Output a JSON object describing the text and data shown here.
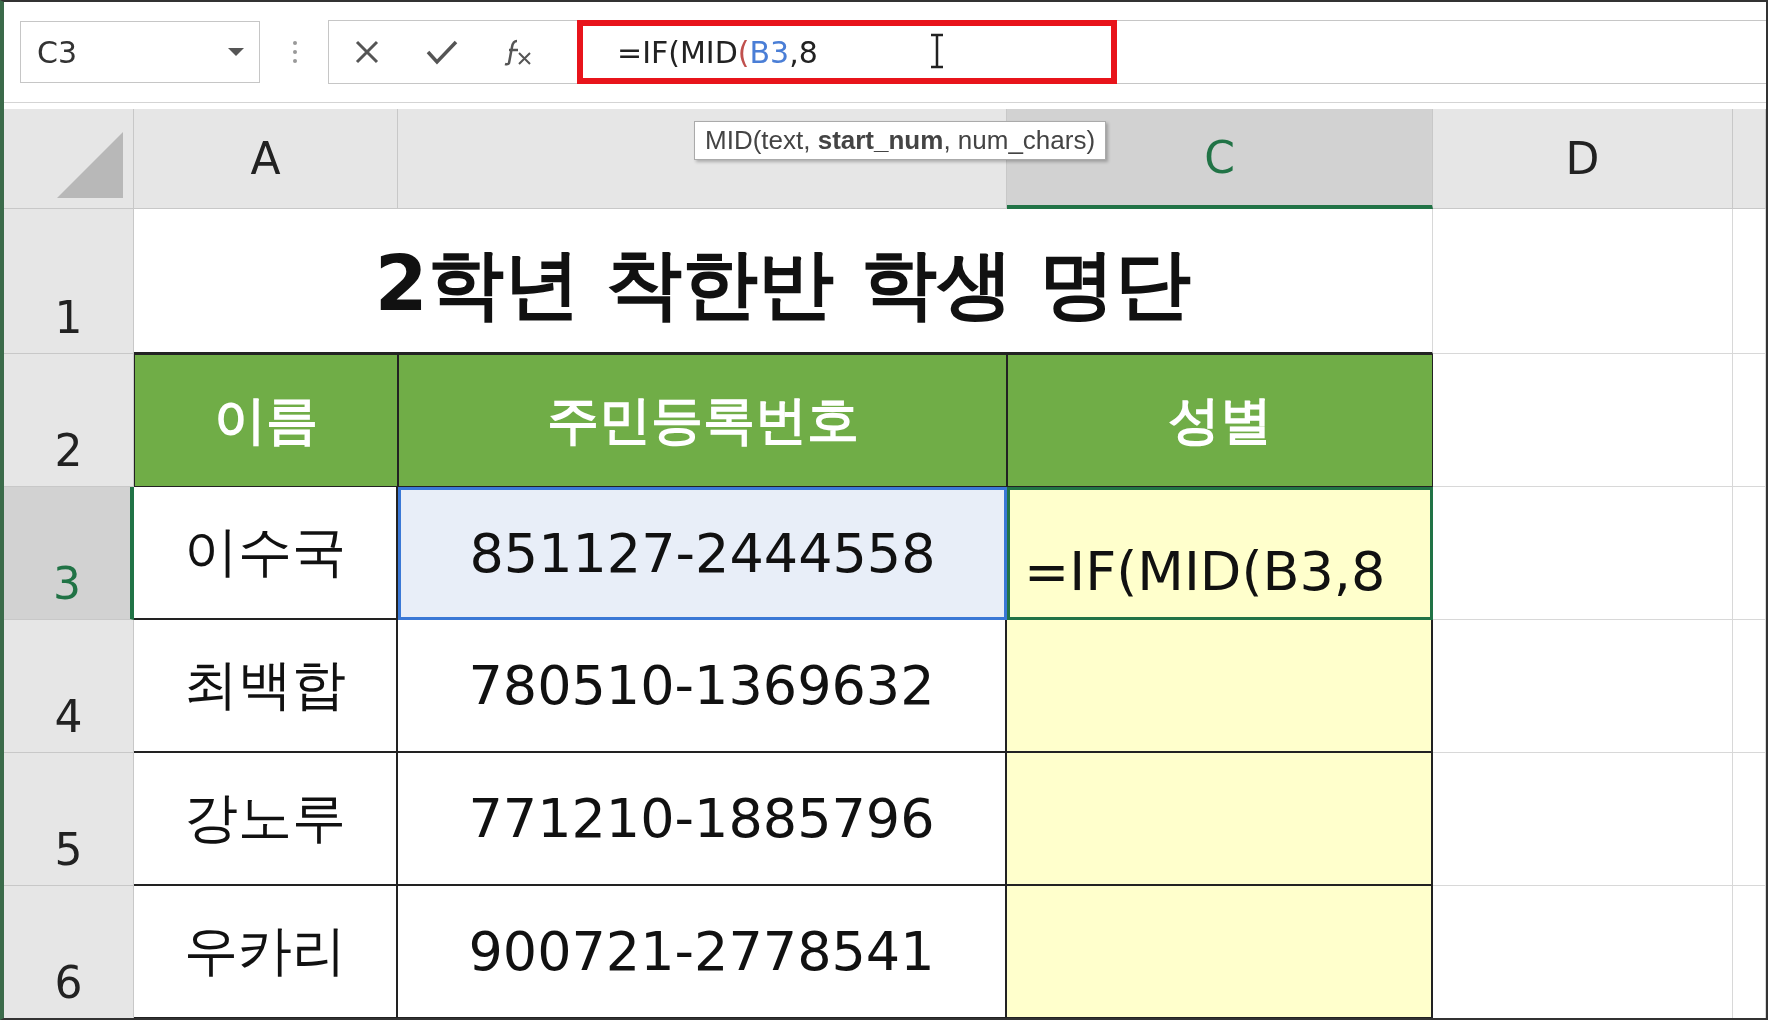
{
  "name_box": {
    "value": "C3"
  },
  "formula_bar": {
    "parts": [
      {
        "text": "=IF(MID",
        "kind": "plain"
      },
      {
        "text": "(",
        "kind": "paren"
      },
      {
        "text": "B3",
        "kind": "ref"
      },
      {
        "text": ",8",
        "kind": "plain"
      }
    ],
    "highlighted": true
  },
  "tooltip": "MID(text, **start_num**, num_chars)",
  "columns": [
    {
      "label": "A",
      "selected": false
    },
    {
      "selected": false
    },
    {
      "label": "C",
      "selected": true
    },
    {
      "label": "D",
      "selected": false
    }
  ],
  "row_numbers": [
    {
      "label": "1",
      "selected": false
    },
    {
      "label": "2",
      "selected": false
    },
    {
      "label": "3",
      "selected": true
    },
    {
      "label": "4",
      "selected": false
    },
    {
      "label": "5",
      "selected": false
    },
    {
      "label": "6",
      "selected": false
    }
  ],
  "title": "2학년 착한반 학생 명단",
  "headers": [
    "이름",
    "주민등록번호",
    "성별"
  ],
  "records": [
    {
      "name": "이수국",
      "id": "851127-2444558",
      "referenced": true,
      "editing": true,
      "formula": "=IF(MID(B3,8"
    },
    {
      "name": "최백합",
      "id": "780510-1369632",
      "referenced": false,
      "editing": false
    },
    {
      "name": "강노루",
      "id": "771210-1885796",
      "referenced": false,
      "editing": false
    },
    {
      "name": "우카리",
      "id": "900721-2778541",
      "referenced": false,
      "editing": false
    }
  ]
}
